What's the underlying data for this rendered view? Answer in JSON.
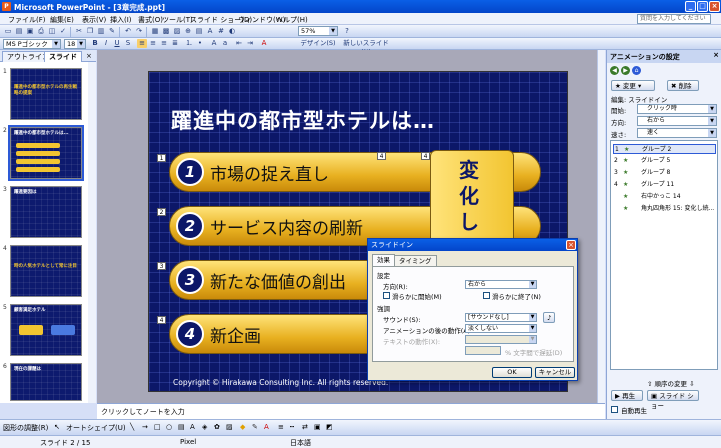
{
  "window": {
    "title": "Microsoft PowerPoint - [3章完成.ppt]",
    "app_icon_letter": "P"
  },
  "menu": {
    "items": [
      "ファイル(F)",
      "編集(E)",
      "表示(V)",
      "挿入(I)",
      "書式(O)",
      "ツール(T)",
      "スライド ショー(D)",
      "ウィンドウ(W)",
      "ヘルプ(H)"
    ],
    "help_placeholder": "質問を入力してください"
  },
  "toolbar": {
    "font_name": "MS Pゴシック",
    "font_size": "18",
    "zoom": "57%",
    "design_label": "デザイン(S)",
    "new_slide_label": "新しいスライド(N)"
  },
  "left_pane": {
    "tabs": [
      "アウトライン",
      "スライド"
    ],
    "slides": [
      {
        "num": "1",
        "text": "躍進中の都市型ホテルの再生戦略の提案"
      },
      {
        "num": "2",
        "text": "躍進中の都市型ホテルは..."
      },
      {
        "num": "3",
        "text": "躍進要因は"
      },
      {
        "num": "4",
        "text": "時の人気ホテルとして常に注目"
      },
      {
        "num": "5",
        "text": "顧客満足ホテル"
      },
      {
        "num": "6",
        "text": "現在の課題は"
      }
    ]
  },
  "slide": {
    "title": "躍進中の都市型ホテルは…",
    "items": [
      {
        "num": "1",
        "text": "市場の捉え直し",
        "tag": "1"
      },
      {
        "num": "2",
        "text": "サービス内容の刷新",
        "tag": "2"
      },
      {
        "num": "3",
        "text": "新たな価値の創出",
        "tag": "3"
      },
      {
        "num": "4",
        "text": "新企画",
        "tag": "4"
      }
    ],
    "change_text": "変化し",
    "top_tags": [
      "4",
      "4"
    ],
    "copyright": "Copyright ©  Hirakawa Consulting Inc.  All rights reserved."
  },
  "notes": {
    "text": "クリックしてノートを入力"
  },
  "task_pane": {
    "title": "アニメーションの設定",
    "change_label": "変更",
    "delete_label": "削除",
    "edit_caption": "編集: スライドイン",
    "start_label": "開始:",
    "start_value": "クリック時",
    "direction_label": "方向:",
    "direction_value": "右から",
    "speed_label": "速さ:",
    "speed_value": "速く",
    "animations": [
      {
        "num": "1",
        "label": "グループ 2"
      },
      {
        "num": "2",
        "label": "グループ 5"
      },
      {
        "num": "3",
        "label": "グループ 8"
      },
      {
        "num": "4",
        "label": "グループ 11"
      },
      {
        "num": "",
        "label": "右中かっこ 14"
      },
      {
        "num": "",
        "label": "角丸四角形 15: 変化し続..."
      }
    ],
    "reorder_label": "順序の変更",
    "play_label": "再生",
    "slideshow_label": "スライド ショー",
    "autopreview_label": "自動再生"
  },
  "dialog": {
    "title": "スライドイン",
    "tabs": [
      "効果",
      "タイミング"
    ],
    "settings_group": "設定",
    "direction_label": "方向(R):",
    "direction_value": "右から",
    "smooth_start": "滑らかに開始(M)",
    "smooth_end": "滑らかに終了(N)",
    "enhance_group": "強調",
    "sound_label": "サウンド(S):",
    "sound_value": "[サウンドなし]",
    "after_label": "アニメーションの後の動作(A):",
    "after_value": "淡くしない",
    "text_anim_label": "テキストの動作(X):",
    "delay_text": "% 文字間で遅延(D)",
    "ok_label": "OK",
    "cancel_label": "キャンセル"
  },
  "drawbar": {
    "draw_label": "図形の調整(R)",
    "autoshape_label": "オートシェイプ(U)"
  },
  "status": {
    "slide": "スライド 2 / 15",
    "design": "Pixel",
    "language": "日本語"
  }
}
